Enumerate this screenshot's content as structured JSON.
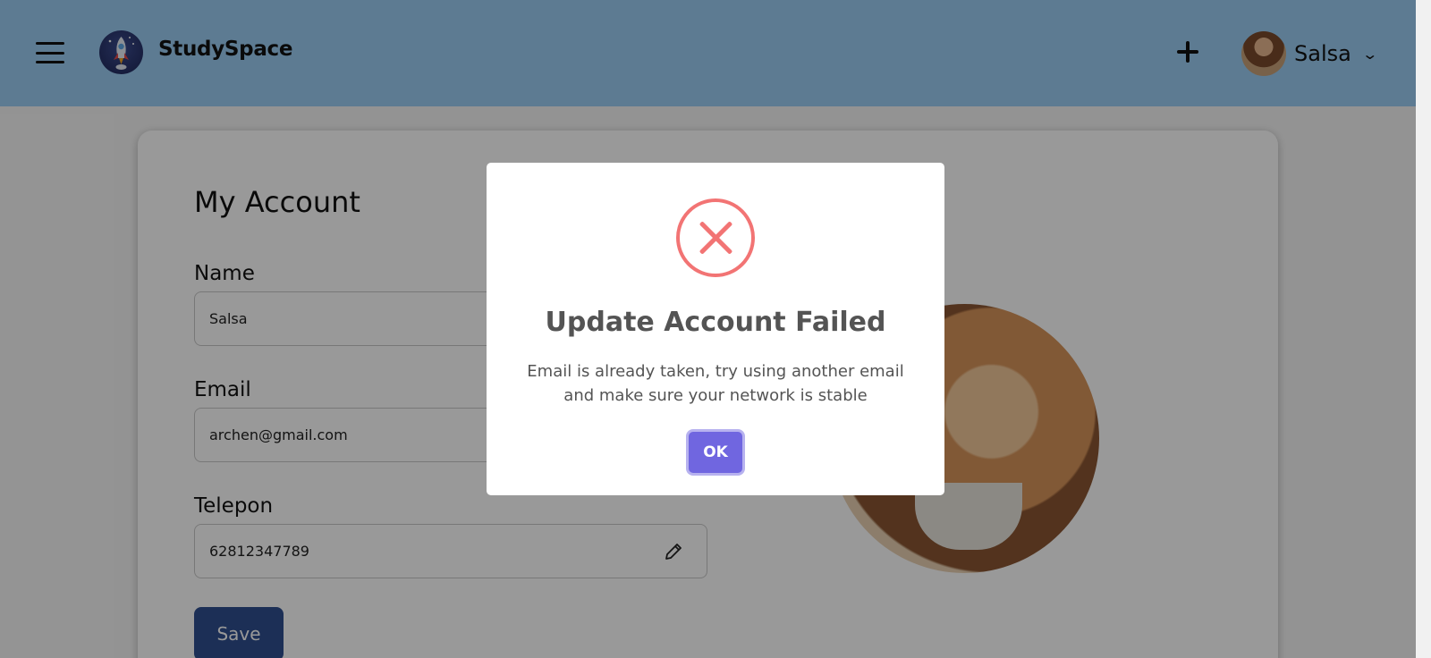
{
  "header": {
    "brand": "StudySpace",
    "username": "Salsa",
    "chevron": "⌄"
  },
  "account": {
    "title": "My Account",
    "name_label": "Name",
    "name_value": "Salsa",
    "email_label": "Email",
    "email_value": "archen@gmail.com",
    "phone_label": "Telepon",
    "phone_value": "62812347789",
    "save_label": "Save"
  },
  "modal": {
    "title": "Update Account Failed",
    "message": "Email is already taken, try using another email and make sure your network is stable",
    "ok_label": "OK"
  },
  "colors": {
    "header": "#9bcdf3",
    "error": "#f27474",
    "confirm": "#7066e0",
    "save": "#2f4f8f"
  }
}
